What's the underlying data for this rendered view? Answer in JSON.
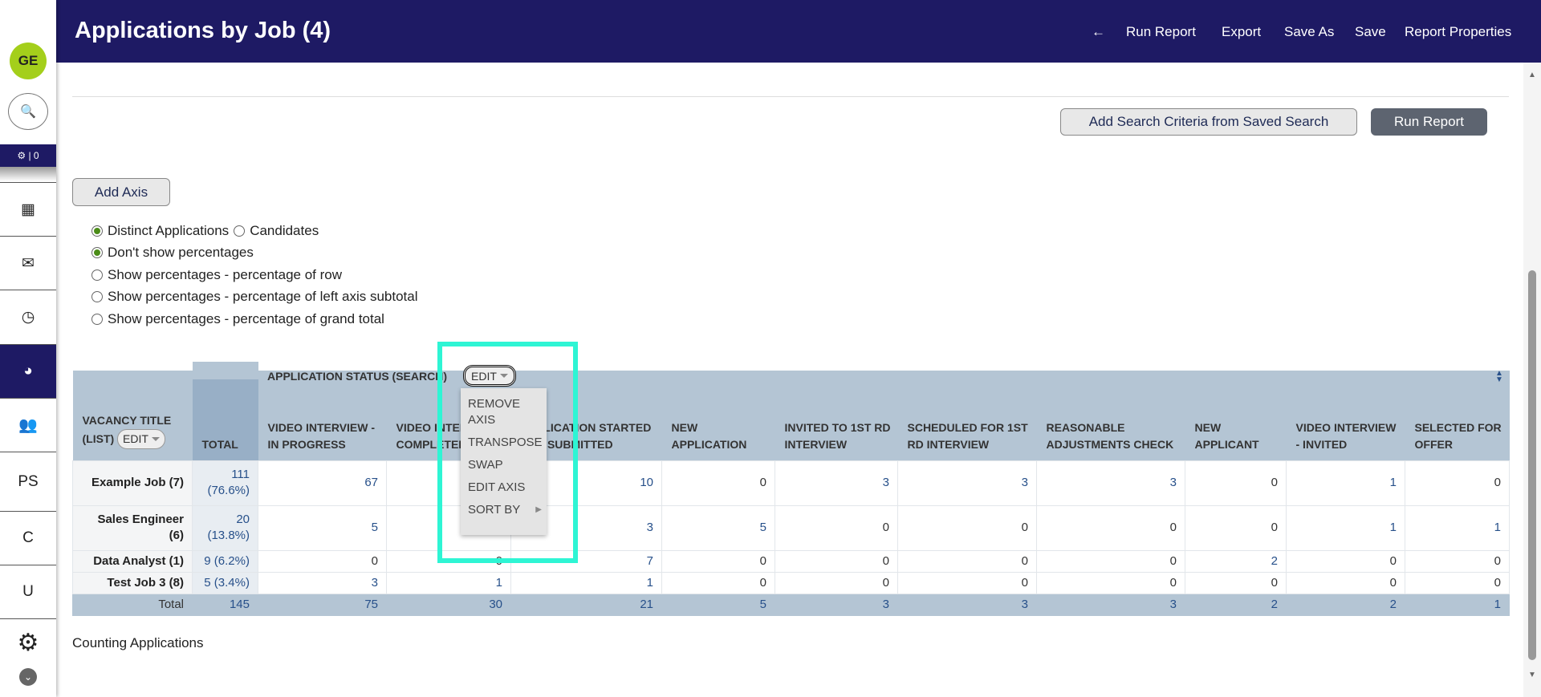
{
  "sidebar": {
    "avatar": "GE",
    "notif": "| 0",
    "items": [
      "PS",
      "C",
      "U"
    ]
  },
  "header": {
    "title": "Applications by Job (4)",
    "back": "←",
    "links": [
      "Run Report",
      "Export",
      "Save As",
      "Save",
      "Report Properties"
    ]
  },
  "actions": {
    "saved_search": "Add Search Criteria from Saved Search",
    "run": "Run Report",
    "add_axis": "Add Axis"
  },
  "options": {
    "count": [
      {
        "label": "Distinct Applications",
        "checked": true
      },
      {
        "label": "Candidates",
        "checked": false
      }
    ],
    "pct": [
      {
        "label": "Don't show percentages",
        "checked": true
      },
      {
        "label": "Show percentages - percentage of row",
        "checked": false
      },
      {
        "label": "Show percentages - percentage of left axis subtotal",
        "checked": false
      },
      {
        "label": "Show percentages - percentage of grand total",
        "checked": false
      }
    ]
  },
  "table": {
    "axis_title": "APPLICATION STATUS (SEARCH)",
    "edit": "EDIT",
    "row_axis": "VACANCY TITLE (LIST)",
    "total_header": "TOTAL",
    "columns": [
      "VIDEO INTERVIEW - IN PROGRESS",
      "VIDEO INTERVIEW COMPLETED",
      "APPLICATION STARTED NOT SUBMITTED",
      "NEW APPLICATION",
      "INVITED TO 1ST RD INTERVIEW",
      "SCHEDULED FOR 1ST RD INTERVIEW",
      "REASONABLE ADJUSTMENTS CHECK",
      "NEW APPLICANT",
      "VIDEO INTERVIEW - INVITED",
      "SELECTED FOR OFFER"
    ],
    "rows": [
      {
        "label": "Example Job (7)",
        "total": "111 (76.6%)",
        "values": [
          "67",
          "",
          "10",
          "0",
          "3",
          "3",
          "3",
          "0",
          "1",
          "0"
        ]
      },
      {
        "label": "Sales Engineer (6)",
        "total": "20 (13.8%)",
        "values": [
          "5",
          "",
          "3",
          "5",
          "0",
          "0",
          "0",
          "0",
          "1",
          "1"
        ]
      },
      {
        "label": "Data Analyst (1)",
        "total": "9 (6.2%)",
        "values": [
          "0",
          "0",
          "7",
          "0",
          "0",
          "0",
          "0",
          "2",
          "0",
          "0"
        ]
      },
      {
        "label": "Test Job 3 (8)",
        "total": "5 (3.4%)",
        "values": [
          "3",
          "1",
          "1",
          "0",
          "0",
          "0",
          "0",
          "0",
          "0",
          "0"
        ]
      }
    ],
    "totals": {
      "label": "Total",
      "total": "145",
      "values": [
        "75",
        "30",
        "21",
        "5",
        "3",
        "3",
        "3",
        "2",
        "2",
        "1"
      ]
    }
  },
  "menu": [
    "REMOVE AXIS",
    "TRANSPOSE",
    "SWAP",
    "EDIT AXIS",
    "SORT BY"
  ],
  "footer": "Counting Applications",
  "colors": {
    "header": "#1e1a64",
    "highlight": "#2ef5d4"
  }
}
